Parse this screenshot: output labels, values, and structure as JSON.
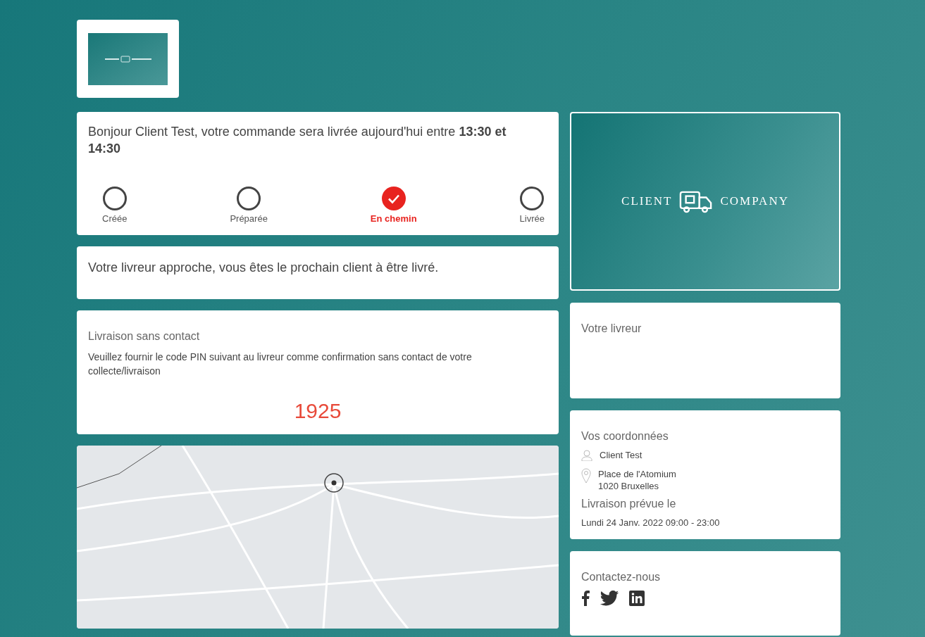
{
  "banner_logo": {
    "left": "CLIENT",
    "right": "COMPANY"
  },
  "status": {
    "message": "Bonjour Client Test, votre commande sera livrée aujourd'hui entre **13:30 et 14:30**",
    "steps": [
      {
        "label": "Créée",
        "selected": false
      },
      {
        "label": "Préparée",
        "selected": false
      },
      {
        "label": "En chemin",
        "selected": true
      },
      {
        "label": "Livrée",
        "selected": false
      }
    ]
  },
  "notice": "Votre livreur approche, vous êtes le prochain client à être livré.",
  "contactless": {
    "title": "Livraison sans contact",
    "text": "Veuillez fournir le code PIN suivant au livreur comme confirmation sans contact de votre collecte/livraison",
    "pin": "1925"
  },
  "driver": {
    "title": "Votre livreur"
  },
  "details": {
    "title": "Vos coordonnées",
    "name": "Client Test",
    "address": [
      "Place de l'Atomium",
      "1020 Bruxelles"
    ],
    "delivery_title": "Livraison prévue le",
    "delivery_date": "Lundi 24 Janv. 2022 09:00 - 23:00"
  },
  "contact": {
    "title": "Contactez-nous"
  }
}
